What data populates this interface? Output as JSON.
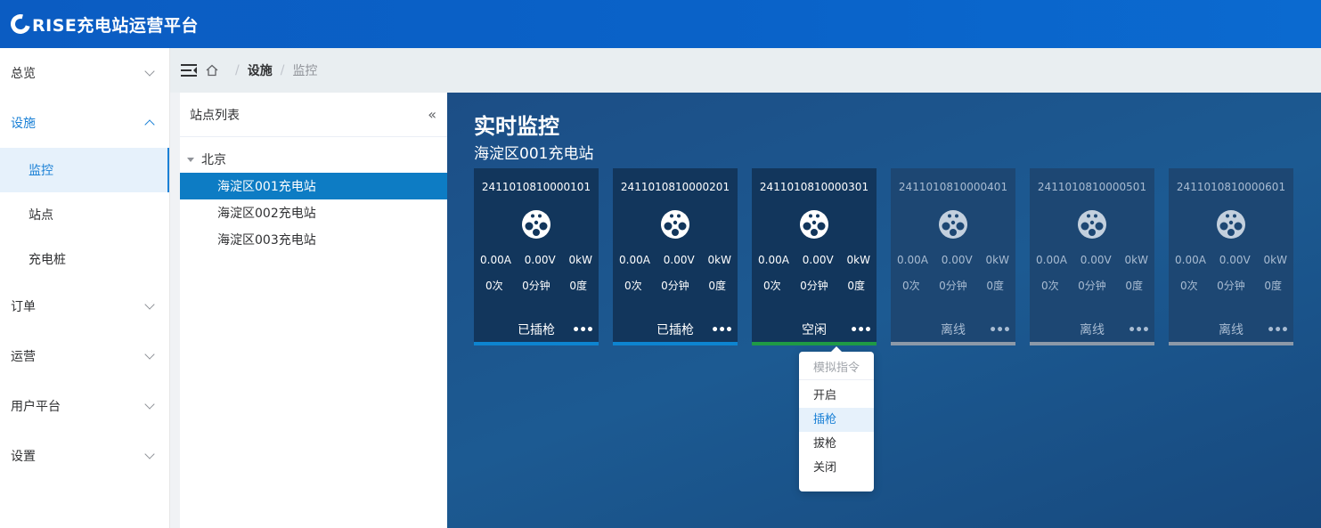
{
  "header": {
    "brand": "RISE充电站运营平台"
  },
  "sidebar": {
    "items": [
      {
        "label": "总览"
      },
      {
        "label": "设施"
      },
      {
        "label": "订单"
      },
      {
        "label": "运营"
      },
      {
        "label": "用户平台"
      },
      {
        "label": "设置"
      }
    ],
    "subitems": [
      {
        "label": "监控"
      },
      {
        "label": "站点"
      },
      {
        "label": "充电桩"
      }
    ]
  },
  "breadcrumb": {
    "level1": "设施",
    "level2": "监控"
  },
  "station_panel": {
    "title": "站点列表",
    "collapse_glyph": "«",
    "root": "北京",
    "stations": [
      "海淀区001充电站",
      "海淀区002充电站",
      "海淀区003充电站"
    ]
  },
  "monitor": {
    "title": "实时监控",
    "station_name": "海淀区001充电站",
    "cards": [
      {
        "id": "2411010810000101",
        "current": "0.00A",
        "voltage": "0.00V",
        "power": "0kW",
        "count": "0次",
        "duration": "0分钟",
        "energy": "0度",
        "status": "已插枪",
        "bar_color": "#0d84d0"
      },
      {
        "id": "2411010810000201",
        "current": "0.00A",
        "voltage": "0.00V",
        "power": "0kW",
        "count": "0次",
        "duration": "0分钟",
        "energy": "0度",
        "status": "已插枪",
        "bar_color": "#0d84d0"
      },
      {
        "id": "2411010810000301",
        "current": "0.00A",
        "voltage": "0.00V",
        "power": "0kW",
        "count": "0次",
        "duration": "0分钟",
        "energy": "0度",
        "status": "空闲",
        "bar_color": "#1f9a45"
      },
      {
        "id": "2411010810000401",
        "current": "0.00A",
        "voltage": "0.00V",
        "power": "0kW",
        "count": "0次",
        "duration": "0分钟",
        "energy": "0度",
        "status": "离线",
        "bar_color": "#8c99a8"
      },
      {
        "id": "2411010810000501",
        "current": "0.00A",
        "voltage": "0.00V",
        "power": "0kW",
        "count": "0次",
        "duration": "0分钟",
        "energy": "0度",
        "status": "离线",
        "bar_color": "#8c99a8"
      },
      {
        "id": "2411010810000601",
        "current": "0.00A",
        "voltage": "0.00V",
        "power": "0kW",
        "count": "0次",
        "duration": "0分钟",
        "energy": "0度",
        "status": "离线",
        "bar_color": "#8c99a8"
      }
    ],
    "more_glyph": "•••"
  },
  "dropdown": {
    "header": "模拟指令",
    "items": [
      "开启",
      "插枪",
      "拔枪",
      "关闭"
    ]
  }
}
